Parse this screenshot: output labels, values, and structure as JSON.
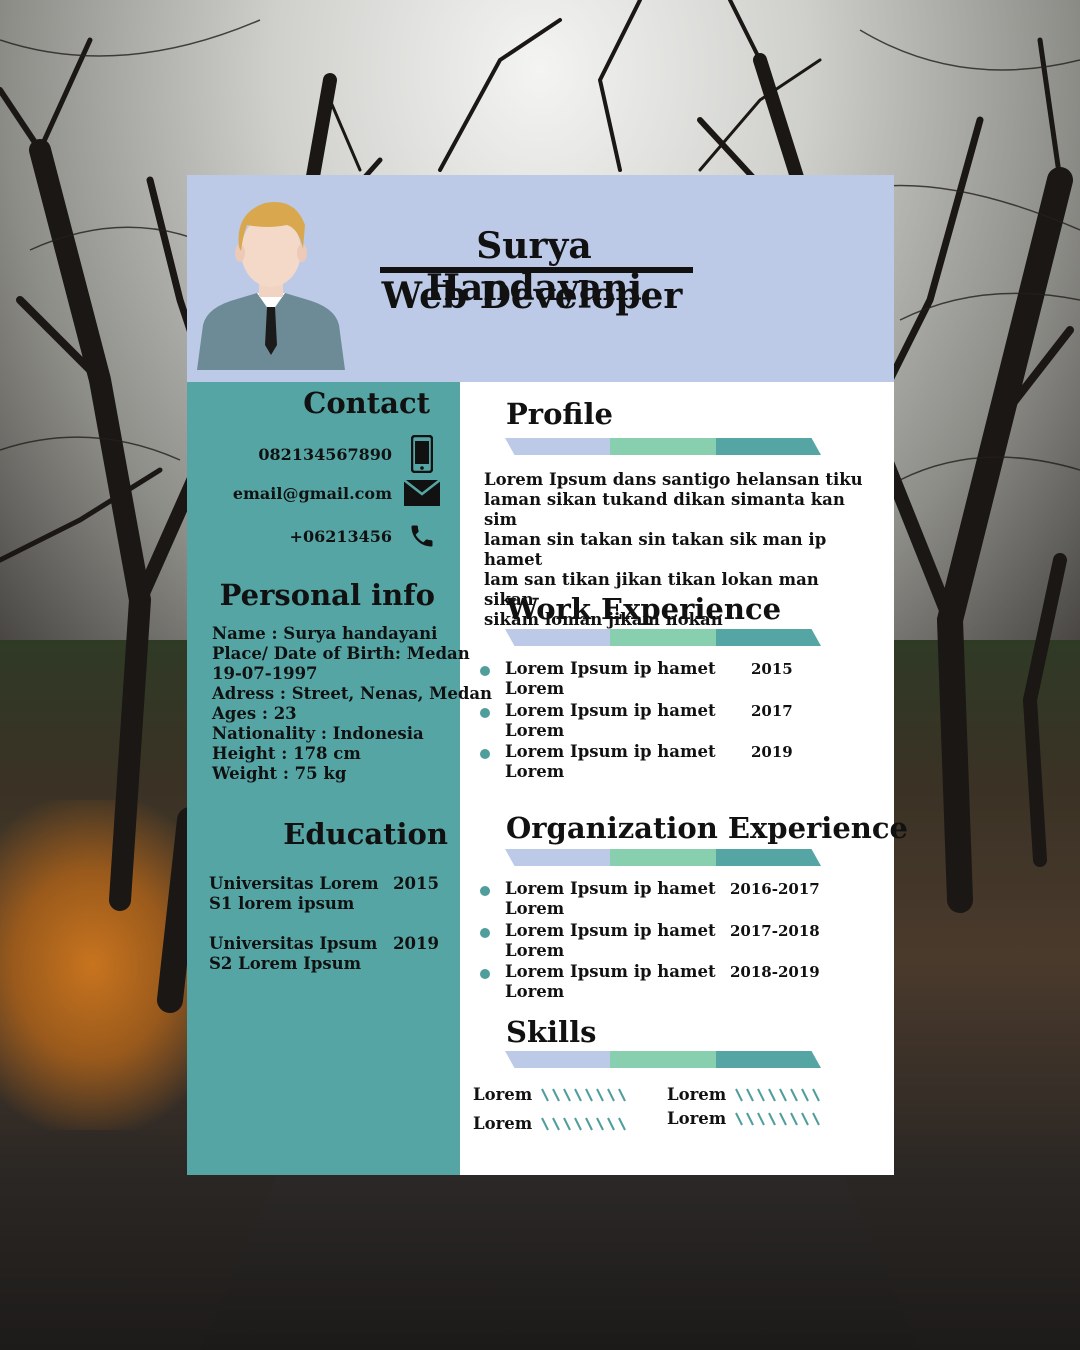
{
  "header": {
    "name": "Surya Handayani",
    "role": "Web Developer"
  },
  "contact": {
    "heading": "Contact",
    "phone": "082134567890",
    "email": "email@gmail.com",
    "telephone": "+06213456",
    "icons": [
      "smartphone-icon",
      "envelope-icon",
      "phone-handset-icon"
    ]
  },
  "personal_info": {
    "heading": "Personal info",
    "lines": [
      "Name : Surya handayani",
      "Place/ Date of Birth: Medan",
      "19-07-1997",
      "Adress : Street, Nenas, Medan",
      "Ages : 23",
      "Nationality : Indonesia",
      "Height : 178 cm",
      "Weight : 75 kg"
    ]
  },
  "education": {
    "heading": "Education",
    "items": [
      {
        "school": "Universitas Lorem",
        "year": "2015",
        "degree": "S1 lorem ipsum"
      },
      {
        "school": "Universitas Ipsum",
        "year": "2019",
        "degree": "S2 Lorem Ipsum"
      }
    ]
  },
  "profile": {
    "heading": "Profile",
    "lines": [
      "Lorem Ipsum dans santigo helansan tiku",
      "laman sikan tukand dikan simanta kan sim",
      "laman sin takan sin takan sik man ip hamet",
      "lam san tikan jikan tikan lokan man sikan",
      "sikam loman jikam nokan"
    ]
  },
  "work_experience": {
    "heading": "Work Experience",
    "items": [
      {
        "title": "Lorem Ipsum ip hamet",
        "sub": "Lorem",
        "year": "2015"
      },
      {
        "title": "Lorem Ipsum ip hamet",
        "sub": "Lorem",
        "year": "2017"
      },
      {
        "title": "Lorem Ipsum ip hamet",
        "sub": "Lorem",
        "year": "2019"
      }
    ]
  },
  "organization_experience": {
    "heading": "Organization Experience",
    "items": [
      {
        "title": "Lorem Ipsum ip hamet",
        "sub": "Lorem",
        "year": "2016-2017"
      },
      {
        "title": "Lorem Ipsum ip hamet",
        "sub": "Lorem",
        "year": "2017-2018"
      },
      {
        "title": "Lorem Ipsum ip hamet",
        "sub": "Lorem",
        "year": "2018-2019"
      }
    ]
  },
  "skills": {
    "heading": "Skills",
    "items": [
      "Lorem",
      "Lorem",
      "Lorem",
      "Lorem"
    ]
  },
  "colors": {
    "header_bg": "#bccae8",
    "sidebar_bg": "#56a5a5",
    "bar_segments": [
      "#bccae8",
      "#88cfb0",
      "#56a5a5"
    ],
    "bullet": "#4f9e9c"
  }
}
